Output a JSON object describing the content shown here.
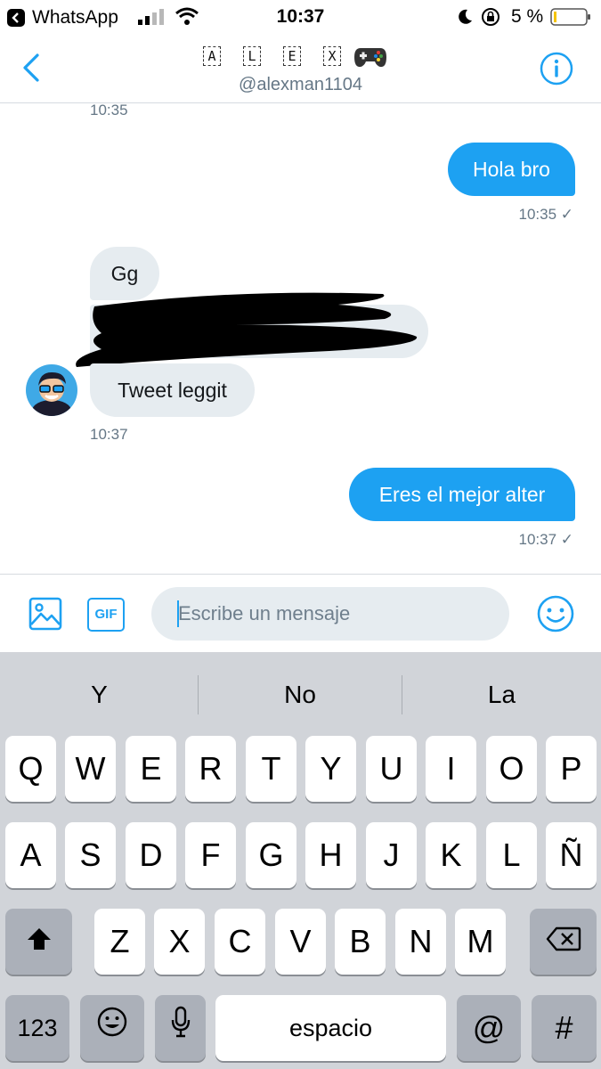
{
  "status_bar": {
    "back_app": "WhatsApp",
    "time": "10:37",
    "battery": "5 %"
  },
  "header": {
    "name_letters": [
      "A",
      "L",
      "E",
      "X"
    ],
    "handle": "@alexman1104"
  },
  "messages": {
    "t_top": "10:35",
    "out1": {
      "text": "Hola bro",
      "time": "10:35 ✓"
    },
    "in_bubbles": [
      "Gg",
      "Tweet leggit"
    ],
    "in_time": "10:37",
    "out2": {
      "text": "Eres el mejor alter",
      "time": "10:37 ✓"
    }
  },
  "composer": {
    "placeholder": "Escribe un mensaje",
    "gif_label": "GIF"
  },
  "keyboard": {
    "suggestions": [
      "Y",
      "No",
      "La"
    ],
    "row1": [
      "Q",
      "W",
      "E",
      "R",
      "T",
      "Y",
      "U",
      "I",
      "O",
      "P"
    ],
    "row2": [
      "A",
      "S",
      "D",
      "F",
      "G",
      "H",
      "J",
      "K",
      "L",
      "Ñ"
    ],
    "row3": [
      "Z",
      "X",
      "C",
      "V",
      "B",
      "N",
      "M"
    ],
    "numbers": "123",
    "space": "espacio",
    "at": "@",
    "hash": "#"
  },
  "colors": {
    "accent": "#1da1f2",
    "bubble_in": "#e6ecf0",
    "keyboard_bg": "#d1d4d9"
  }
}
